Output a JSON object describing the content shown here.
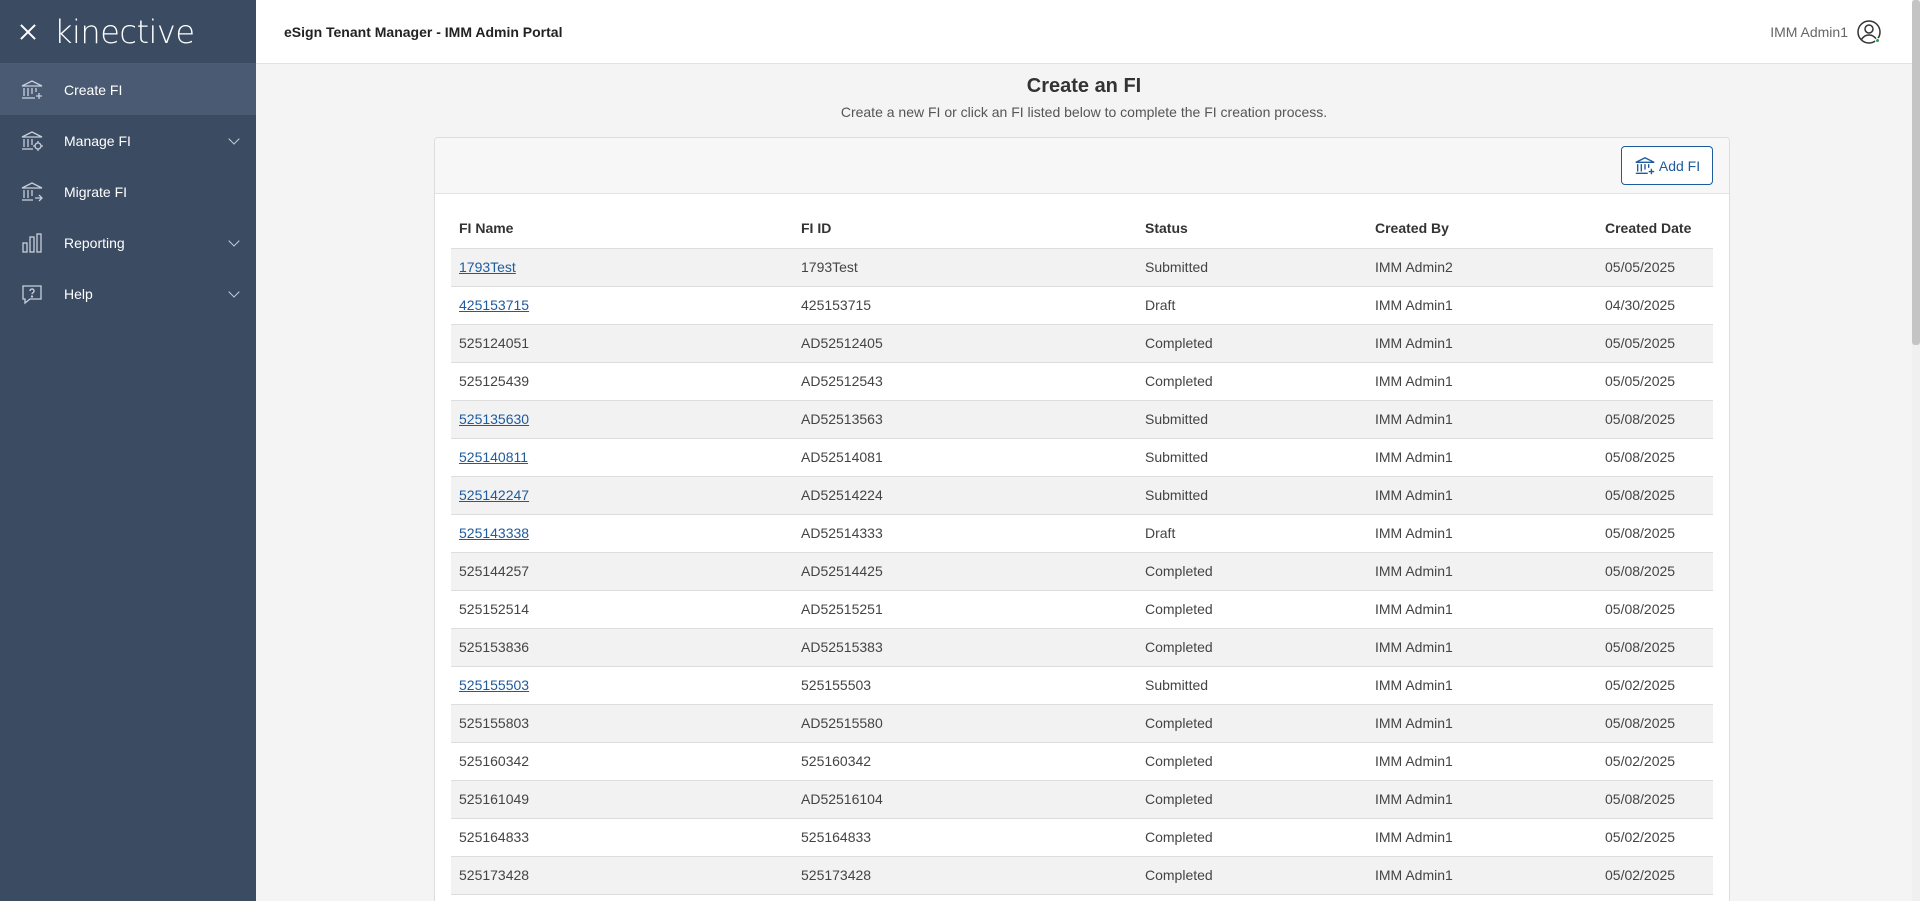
{
  "sidebar": {
    "logo": "kinective",
    "items": [
      {
        "label": "Create FI"
      },
      {
        "label": "Manage FI"
      },
      {
        "label": "Migrate FI"
      },
      {
        "label": "Reporting"
      },
      {
        "label": "Help"
      }
    ]
  },
  "header": {
    "title": "eSign Tenant Manager - IMM Admin Portal",
    "user": "IMM Admin1"
  },
  "main": {
    "title": "Create an FI",
    "subtitle": "Create a new FI or click an FI listed below to complete the FI creation process.",
    "add_button": "Add FI"
  },
  "table": {
    "headers": [
      "FI Name",
      "FI ID",
      "Status",
      "Created By",
      "Created Date"
    ],
    "rows": [
      {
        "name": "1793Test",
        "id": "1793Test",
        "status": "Submitted",
        "by": "IMM Admin2",
        "date": "05/05/2025",
        "link": true
      },
      {
        "name": "425153715",
        "id": "425153715",
        "status": "Draft",
        "by": "IMM Admin1",
        "date": "04/30/2025",
        "link": true
      },
      {
        "name": "525124051",
        "id": "AD52512405",
        "status": "Completed",
        "by": "IMM Admin1",
        "date": "05/05/2025",
        "link": false
      },
      {
        "name": "525125439",
        "id": "AD52512543",
        "status": "Completed",
        "by": "IMM Admin1",
        "date": "05/05/2025",
        "link": false
      },
      {
        "name": "525135630",
        "id": "AD52513563",
        "status": "Submitted",
        "by": "IMM Admin1",
        "date": "05/08/2025",
        "link": true
      },
      {
        "name": "525140811",
        "id": "AD52514081",
        "status": "Submitted",
        "by": "IMM Admin1",
        "date": "05/08/2025",
        "link": true
      },
      {
        "name": "525142247",
        "id": "AD52514224",
        "status": "Submitted",
        "by": "IMM Admin1",
        "date": "05/08/2025",
        "link": true
      },
      {
        "name": "525143338",
        "id": "AD52514333",
        "status": "Draft",
        "by": "IMM Admin1",
        "date": "05/08/2025",
        "link": true
      },
      {
        "name": "525144257",
        "id": "AD52514425",
        "status": "Completed",
        "by": "IMM Admin1",
        "date": "05/08/2025",
        "link": false
      },
      {
        "name": "525152514",
        "id": "AD52515251",
        "status": "Completed",
        "by": "IMM Admin1",
        "date": "05/08/2025",
        "link": false
      },
      {
        "name": "525153836",
        "id": "AD52515383",
        "status": "Completed",
        "by": "IMM Admin1",
        "date": "05/08/2025",
        "link": false
      },
      {
        "name": "525155503",
        "id": "525155503",
        "status": "Submitted",
        "by": "IMM Admin1",
        "date": "05/02/2025",
        "link": true
      },
      {
        "name": "525155803",
        "id": "AD52515580",
        "status": "Completed",
        "by": "IMM Admin1",
        "date": "05/08/2025",
        "link": false
      },
      {
        "name": "525160342",
        "id": "525160342",
        "status": "Completed",
        "by": "IMM Admin1",
        "date": "05/02/2025",
        "link": false
      },
      {
        "name": "525161049",
        "id": "AD52516104",
        "status": "Completed",
        "by": "IMM Admin1",
        "date": "05/08/2025",
        "link": false
      },
      {
        "name": "525164833",
        "id": "525164833",
        "status": "Completed",
        "by": "IMM Admin1",
        "date": "05/02/2025",
        "link": false
      },
      {
        "name": "525173428",
        "id": "525173428",
        "status": "Completed",
        "by": "IMM Admin1",
        "date": "05/02/2025",
        "link": false
      }
    ]
  }
}
